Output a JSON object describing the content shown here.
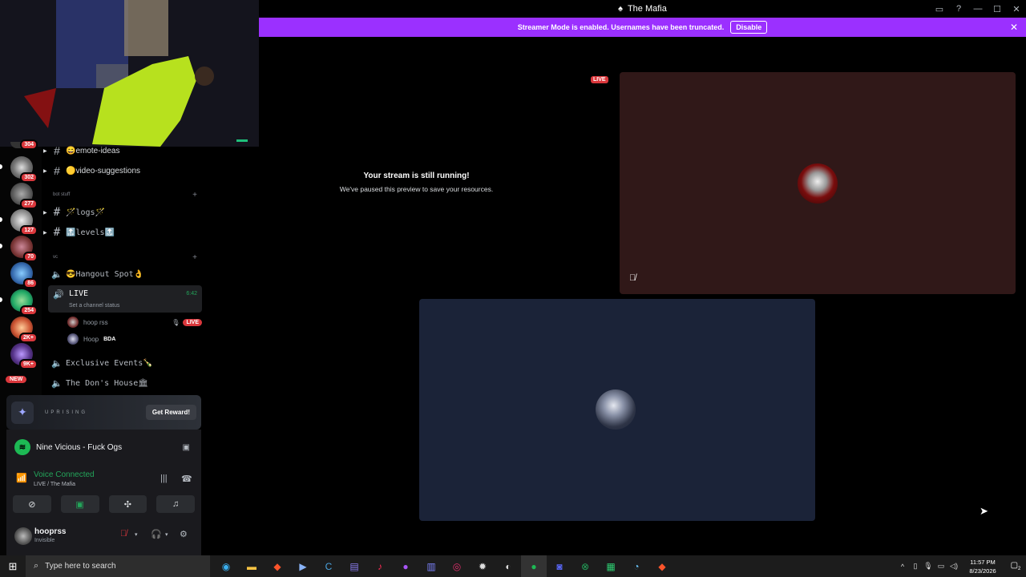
{
  "window": {
    "title": "The Mafia",
    "title_icon": "app-icon"
  },
  "banner": {
    "text": "Streamer Mode is enabled. Usernames have been truncated.",
    "disable_label": "Disable"
  },
  "rail": {
    "badges": [
      "304",
      "302",
      "277",
      "127",
      "70",
      "86",
      "254",
      "2K+",
      "9K+"
    ],
    "new_label": "NEW"
  },
  "channels": {
    "text_channels": [
      {
        "name": "😄emote-ideas"
      },
      {
        "name": "🟡video-suggestions"
      }
    ],
    "category_bot": "bot stuff",
    "bot_channels": [
      {
        "name": "🪄logs🪄"
      },
      {
        "name": "🔝levels🔝"
      }
    ],
    "category_vc": "vc",
    "voice_channels": [
      {
        "name": "😎Hangout Spot👌"
      },
      {
        "name": "Exclusive Events🍾"
      },
      {
        "name": "The Don's House🏛"
      }
    ],
    "live_channel": {
      "name": "LIVE",
      "timer": "6:42",
      "status_placeholder": "Set a channel status"
    },
    "voice_users": [
      {
        "name": "hoop rss",
        "badge": "LIVE"
      },
      {
        "name": "Hoop",
        "badge": "BDA"
      }
    ]
  },
  "promo": {
    "brand": "UPRISING",
    "button": "Get Reward!"
  },
  "spotify": {
    "track": "Nine Vicious - Fuck Ogs"
  },
  "voice": {
    "status": "Voice Connected",
    "location": "LIVE / The Mafia"
  },
  "user": {
    "name": "hooprss",
    "status": "Invisible"
  },
  "stage": {
    "title": "Your stream is still running!",
    "subtitle": "We've paused this preview to save your resources.",
    "live_tag": "LIVE"
  },
  "taskbar": {
    "search_placeholder": "Type here to search",
    "time": "11:57 PM",
    "date": "8/23/2026",
    "notification_count": "2"
  },
  "colors": {
    "banner": "#9b30ff",
    "live_red": "#da373c",
    "voice_green": "#23a55a",
    "tile_red": "#301818",
    "tile_blue": "#1b2338"
  }
}
